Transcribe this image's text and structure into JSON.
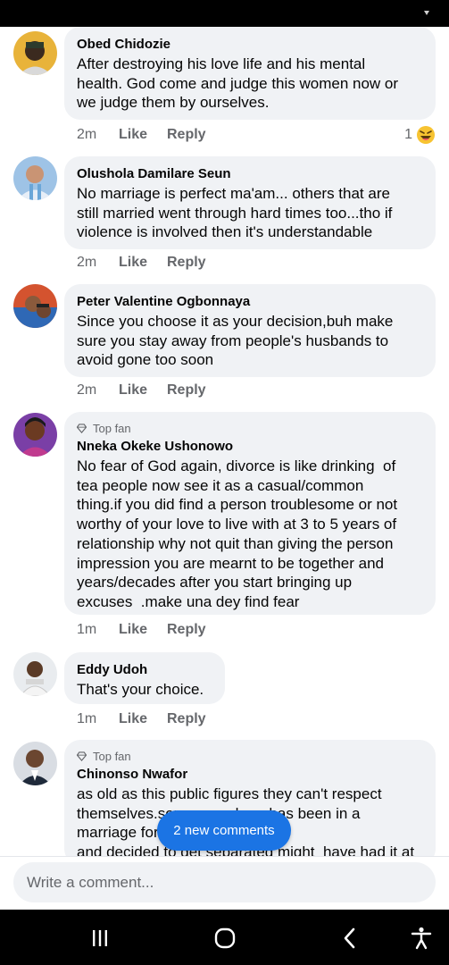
{
  "comments": [
    {
      "name": "Obed Chidozie",
      "top_fan": "",
      "text": "After destroying his love life and his mental\nhealth. God come and judge this women now or\nwe judge them by ourselves.",
      "time": "2m",
      "like_label": "Like",
      "reply_label": "Reply",
      "reaction_count": "1",
      "reaction_icon": "laughing-emoji-icon"
    },
    {
      "name": "Olushola Damilare Seun",
      "top_fan": "",
      "text": "No marriage is perfect ma'am... others that are\nstill married went through hard times too...tho if\nviolence is involved then it's understandable",
      "time": "2m",
      "like_label": "Like",
      "reply_label": "Reply"
    },
    {
      "name": "Peter Valentine Ogbonnaya",
      "top_fan": "",
      "text": "Since you choose it as your decision,buh make\nsure you stay away from people's husbands to\navoid gone too soon",
      "time": "2m",
      "like_label": "Like",
      "reply_label": "Reply"
    },
    {
      "name": "Nneka Okeke Ushonowo",
      "top_fan": "Top fan",
      "text": "No fear of God again, divorce is like drinking  of\ntea people now see it as a casual/common\nthing.if you did find a person troublesome or not\nworthy of your love to live with at 3 to 5 years of\nrelationship why not quit than giving the person\nimpression you are mearnt to be together and\nyears/decades after you start bringing up\nexcuses  .make una dey find fear",
      "time": "1m",
      "like_label": "Like",
      "reply_label": "Reply"
    },
    {
      "name": "Eddy Udoh",
      "top_fan": "",
      "text": "That's your choice.",
      "time": "1m",
      "like_label": "Like",
      "reply_label": "Reply"
    },
    {
      "name": "Chinonso Nwafor",
      "top_fan": "Top fan",
      "text": "as old as this public figures they can't respect\nthemselves.someone whom has been in a\nmarriage for years,had her kids\nand decided to get separated might  have had it at",
      "time": "",
      "like_label": "",
      "reply_label": ""
    }
  ],
  "new_comments_label": "2 new comments",
  "composer": {
    "placeholder": "Write a comment..."
  },
  "colors": {
    "accent": "#1b74e4",
    "bubble": "#f0f2f5",
    "muted": "#65676b"
  }
}
